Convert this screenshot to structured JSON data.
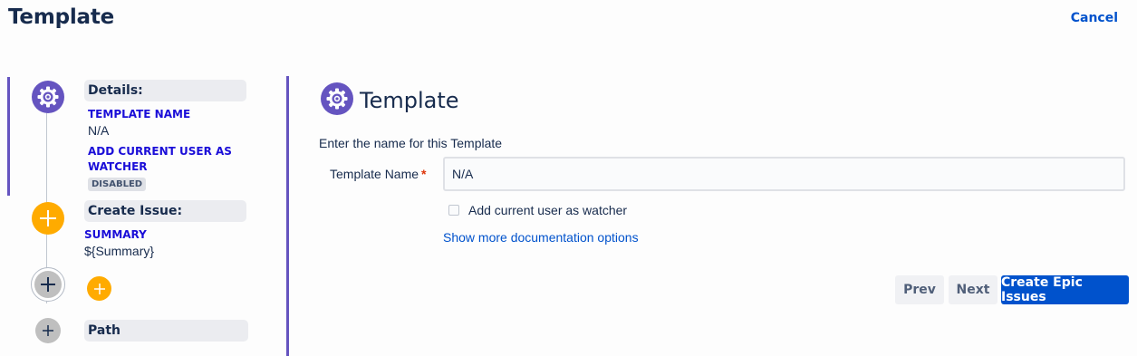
{
  "header": {
    "title": "Template",
    "cancel_label": "Cancel"
  },
  "steps": {
    "details": {
      "header": "Details:",
      "template_name_label": "TEMPLATE NAME",
      "template_name_value": "N/A",
      "add_watcher_label": "ADD CURRENT USER AS WATCHER",
      "add_watcher_badge": "DISABLED"
    },
    "create_issue": {
      "header": "Create Issue:",
      "summary_label": "SUMMARY",
      "summary_value": "${Summary}"
    },
    "path": {
      "header": "Path"
    }
  },
  "form": {
    "title": "Template",
    "intro": "Enter the name for this Template",
    "template_name_label": "Template Name",
    "required_mark": "*",
    "template_name_value": "N/A",
    "watcher_checkbox_label": "Add current user as watcher",
    "watcher_checked": false,
    "doc_link": "Show more documentation options"
  },
  "buttons": {
    "prev": "Prev",
    "next": "Next",
    "create": "Create Epic Issues"
  },
  "colors": {
    "accent_purple": "#6554c0",
    "orange": "#ffab00",
    "primary_blue": "#0052cc",
    "label_blue": "#1a0dd8",
    "required_red": "#de350b"
  },
  "icons": {
    "details_step": "gear-icon",
    "create_issue_step": "plus-icon",
    "add_step": "plus-icon",
    "path_step": "plus-icon",
    "form_header": "gear-icon"
  }
}
